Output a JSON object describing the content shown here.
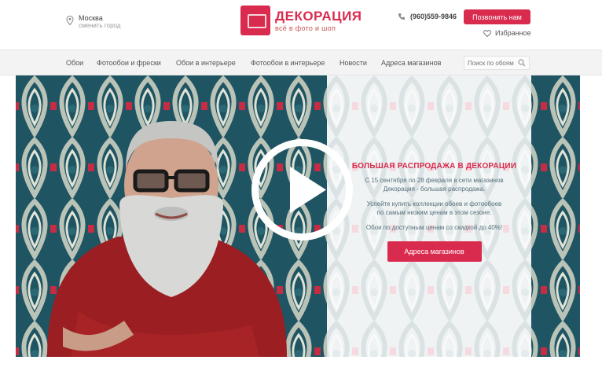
{
  "header": {
    "location": {
      "city": "Москва",
      "subtitle": "сменить город"
    },
    "logo": {
      "name": "ДЕКОРАЦИЯ",
      "tagline": "всё в фото и шоп"
    },
    "phone": "(960)559-9846",
    "callback_label": "Позвонить нам",
    "favorites_label": "Избранное"
  },
  "nav": {
    "items": [
      "Обои",
      "Фотообои и фрески",
      "Обои в интерьере",
      "Фотообои в интерьере",
      "Новости",
      "Адреса магазинов"
    ],
    "search_placeholder": "Поиск по обоям"
  },
  "hero": {
    "promo": {
      "title": "БОЛЬШАЯ РАСПРОДАЖА В ДЕКОРАЦИИ",
      "lines": [
        "С 15 сентября по 28 февраля в сети магазинов",
        "Декорация - большая распродажа.",
        "Успейте купить коллекции обоев и фотообоев",
        "по самым низким ценам в этом сезоне.",
        "Обои по доступным ценам со скидкой до 40%!"
      ],
      "button_label": "Адреса магазинов"
    },
    "play_icon": "play-icon"
  },
  "colors": {
    "brand": "#d92b4e",
    "teal": "#1f5462",
    "nav_bg": "#f3f3f3"
  }
}
